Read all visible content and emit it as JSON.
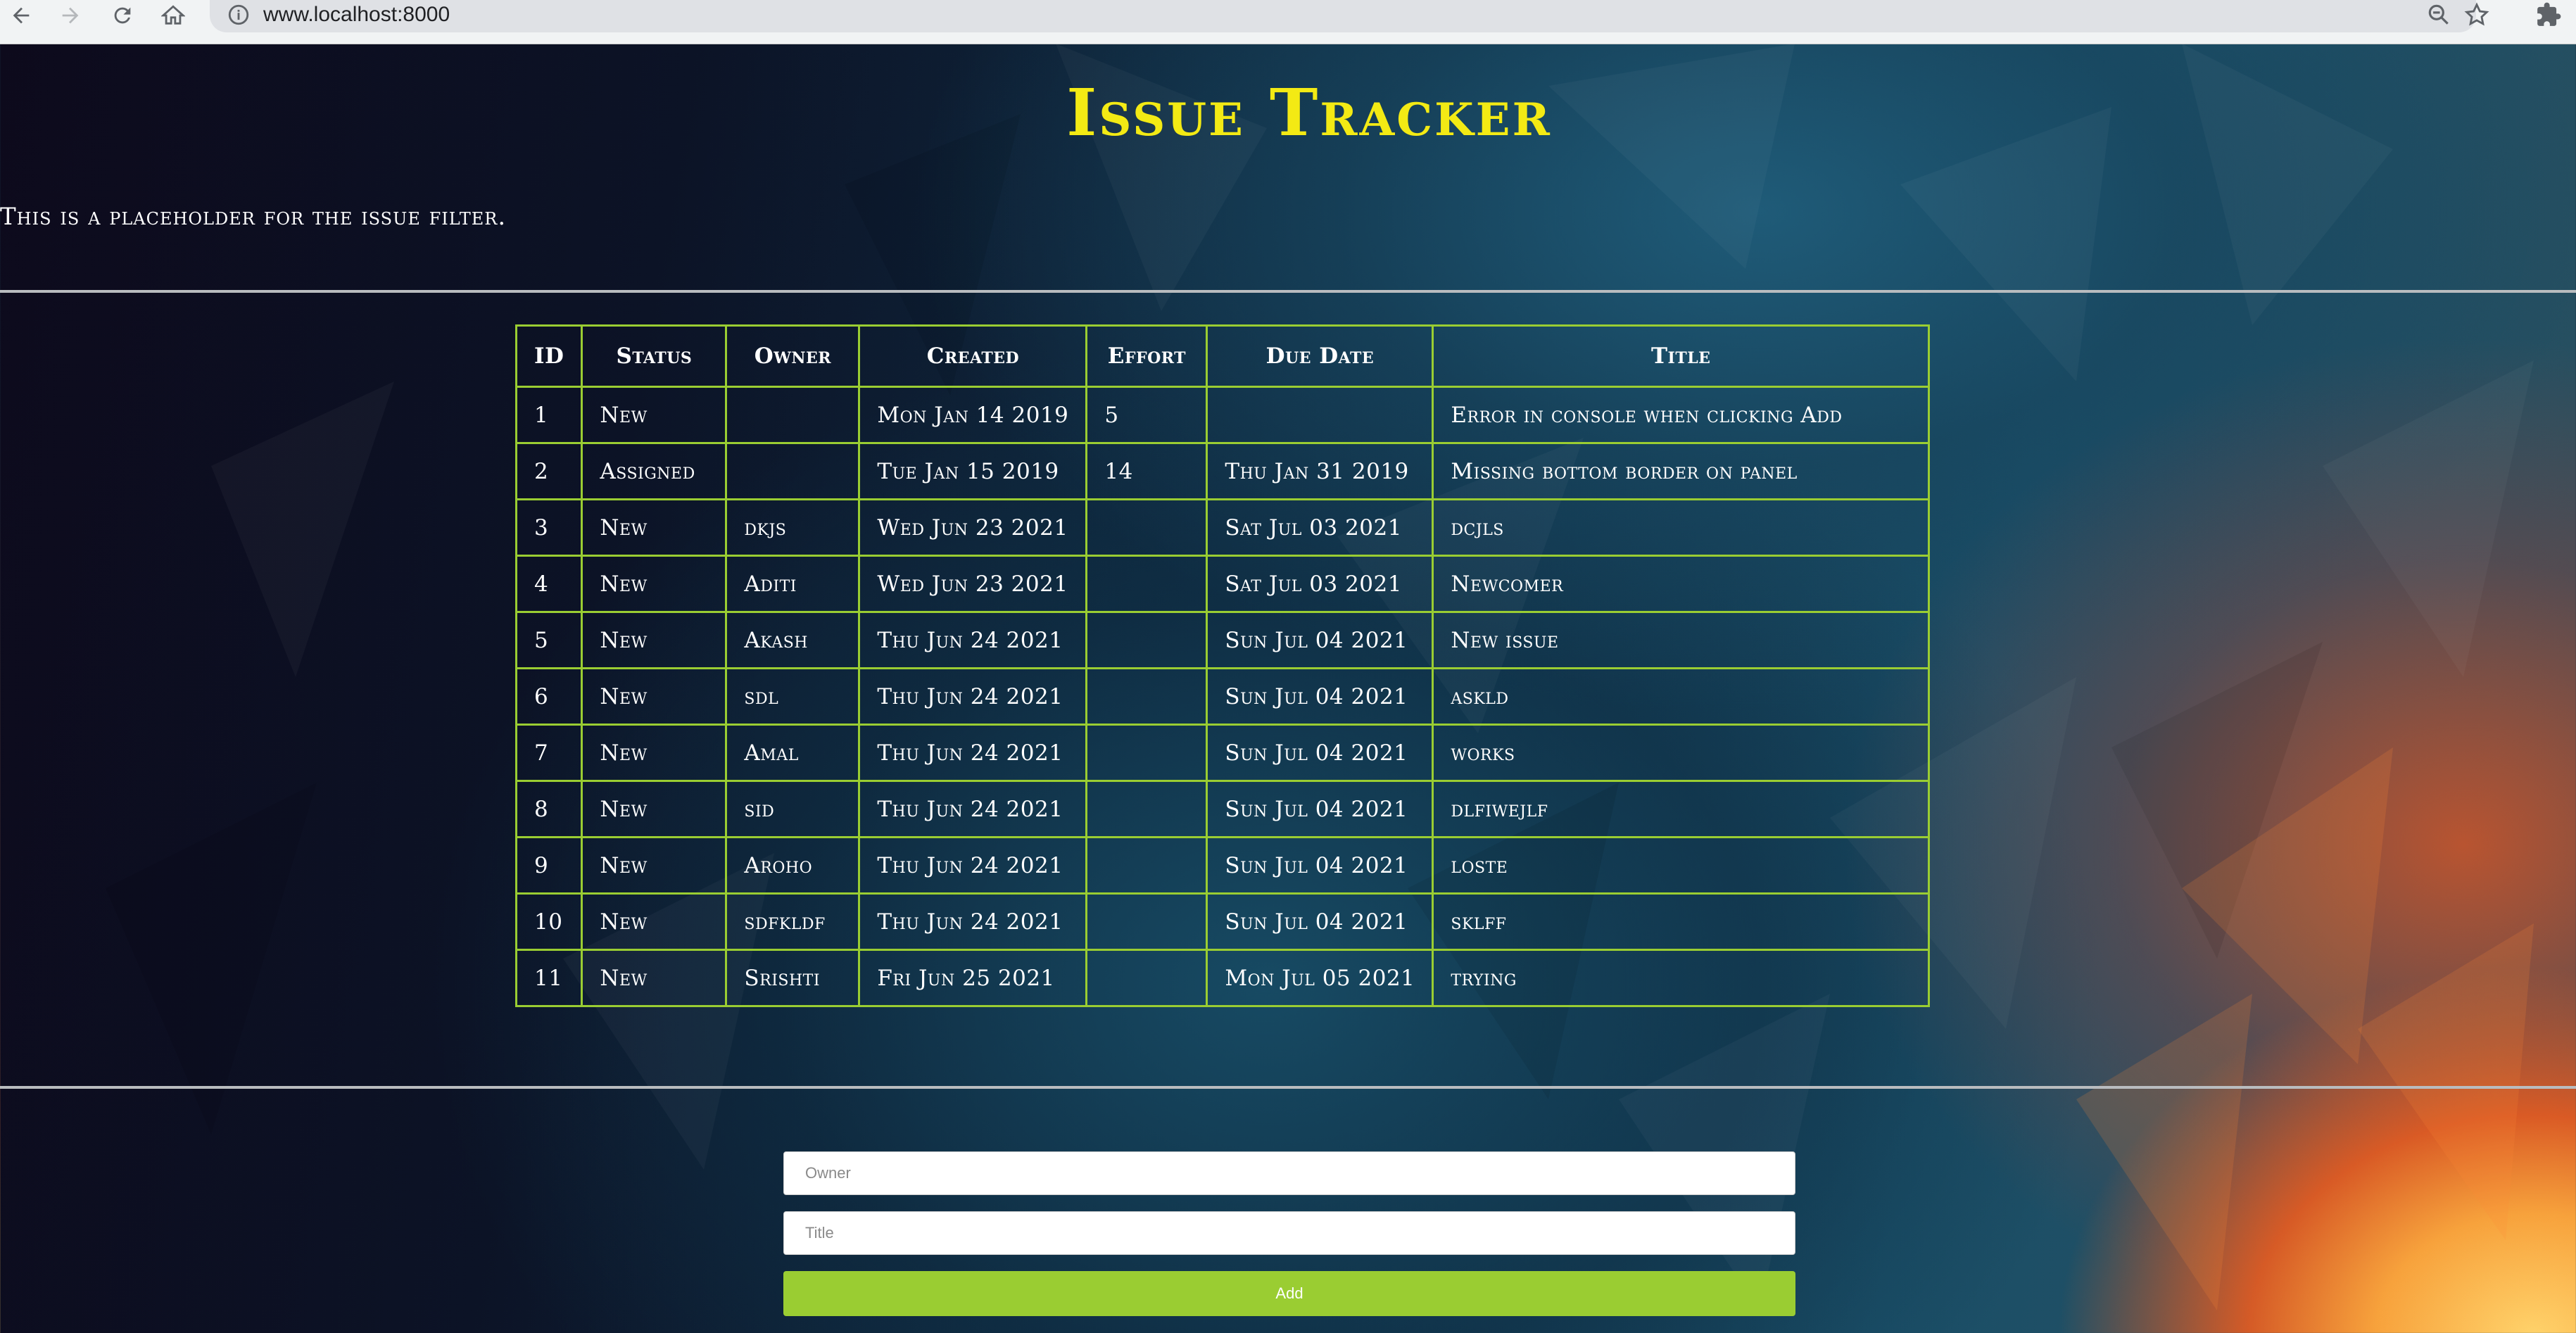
{
  "browser": {
    "url": "www.localhost:8000",
    "icons": [
      "back-icon",
      "forward-icon",
      "reload-icon",
      "home-icon",
      "info-icon",
      "zoom-icon",
      "star-icon",
      "extensions-icon"
    ]
  },
  "page": {
    "title": "Issue Tracker",
    "filter_placeholder": "This is a placeholder for the issue filter."
  },
  "table": {
    "headers": [
      "ID",
      "Status",
      "Owner",
      "Created",
      "Effort",
      "Due Date",
      "Title"
    ],
    "rows": [
      [
        "1",
        "New",
        "",
        "Mon Jan 14 2019",
        "5",
        "",
        "Error in console when clicking Add"
      ],
      [
        "2",
        "Assigned",
        "",
        "Tue Jan 15 2019",
        "14",
        "Thu Jan 31 2019",
        "Missing bottom border on panel"
      ],
      [
        "3",
        "New",
        "dkjs",
        "Wed Jun 23 2021",
        "",
        "Sat Jul 03 2021",
        "dcjls"
      ],
      [
        "4",
        "New",
        "Aditi",
        "Wed Jun 23 2021",
        "",
        "Sat Jul 03 2021",
        "Newcomer"
      ],
      [
        "5",
        "New",
        "Akash",
        "Thu Jun 24 2021",
        "",
        "Sun Jul 04 2021",
        "New issue"
      ],
      [
        "6",
        "New",
        "sdl",
        "Thu Jun 24 2021",
        "",
        "Sun Jul 04 2021",
        "askld"
      ],
      [
        "7",
        "New",
        "Amal",
        "Thu Jun 24 2021",
        "",
        "Sun Jul 04 2021",
        "works"
      ],
      [
        "8",
        "New",
        "sid",
        "Thu Jun 24 2021",
        "",
        "Sun Jul 04 2021",
        "dlfiwejlf"
      ],
      [
        "9",
        "New",
        "Aroho",
        "Thu Jun 24 2021",
        "",
        "Sun Jul 04 2021",
        "loste"
      ],
      [
        "10",
        "New",
        "sdfkldf",
        "Thu Jun 24 2021",
        "",
        "Sun Jul 04 2021",
        "sklff"
      ],
      [
        "11",
        "New",
        "Srishti",
        "Fri Jun 25 2021",
        "",
        "Mon Jul 05 2021",
        "trying"
      ]
    ]
  },
  "form": {
    "owner_placeholder": "Owner",
    "title_placeholder": "Title",
    "add_label": "Add"
  },
  "colors": {
    "title": "#f3ea14",
    "table_border": "#9acd32",
    "add_button": "#9acd32"
  }
}
